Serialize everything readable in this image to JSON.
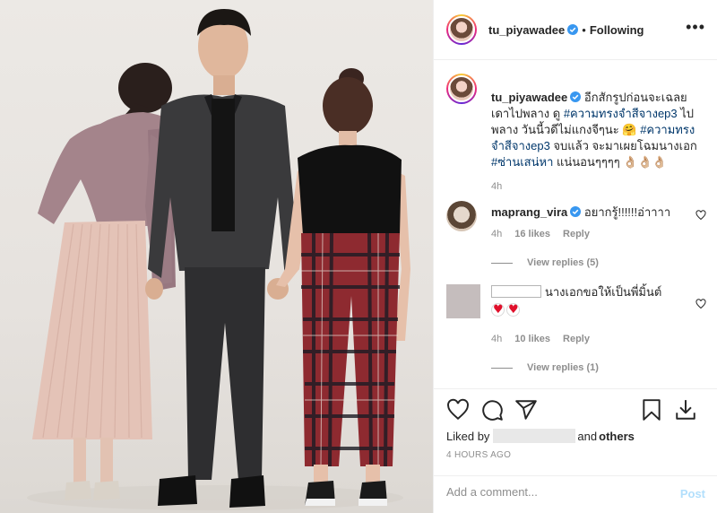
{
  "header": {
    "username": "tu_piyawadee",
    "separator": "•",
    "follow_label": "Following",
    "more_icon": "more-options-icon",
    "verified_icon": "verified-badge-icon"
  },
  "caption": {
    "username": "tu_piyawadee",
    "part1": "อีกสักรูปก่อนจะเฉลย เดาไปพลาง ดู ",
    "tag1": "#ความทรงจำสีจางep3",
    "part2": " ไปพลาง วันนี้วดีไม่แกงจีๆนะ 🤗 ",
    "tag2": "#ความทรงจำสีจางep3",
    "part3": " จบแล้ว จะมาเผยโฉมนางเอก ",
    "tag3": "#ซ่านเสน่หา",
    "part4": " แน่นอนๆๆๆๆ 👌🏼👌🏼👌🏼",
    "time": "4h"
  },
  "comments": [
    {
      "username": "maprang_vira",
      "text": "อยากรู้!!!!!!อ่าาาา",
      "time": "4h",
      "likes": "16 likes",
      "reply_label": "Reply",
      "view_replies": "View replies (5)"
    },
    {
      "username": "",
      "text": "นางเอกขอให้เป็นพี่มิ้นต์",
      "time": "4h",
      "likes": "10 likes",
      "reply_label": "Reply",
      "view_replies": "View replies (1)"
    }
  ],
  "actions": {
    "icons": [
      "heart-icon",
      "comment-icon",
      "share-icon",
      "bookmark-icon",
      "download-icon"
    ]
  },
  "likes_line": {
    "prefix": "Liked by",
    "suffix_and": "and",
    "suffix_others": "others"
  },
  "timestamp": "4 HOURS AGO",
  "add_comment": {
    "placeholder": "Add a comment...",
    "post_label": "Post"
  },
  "colors": {
    "link": "#00376b",
    "muted": "#8e8e8e",
    "post_disabled": "#b2dffc",
    "border": "#efefef",
    "verified": "#3897f0"
  }
}
